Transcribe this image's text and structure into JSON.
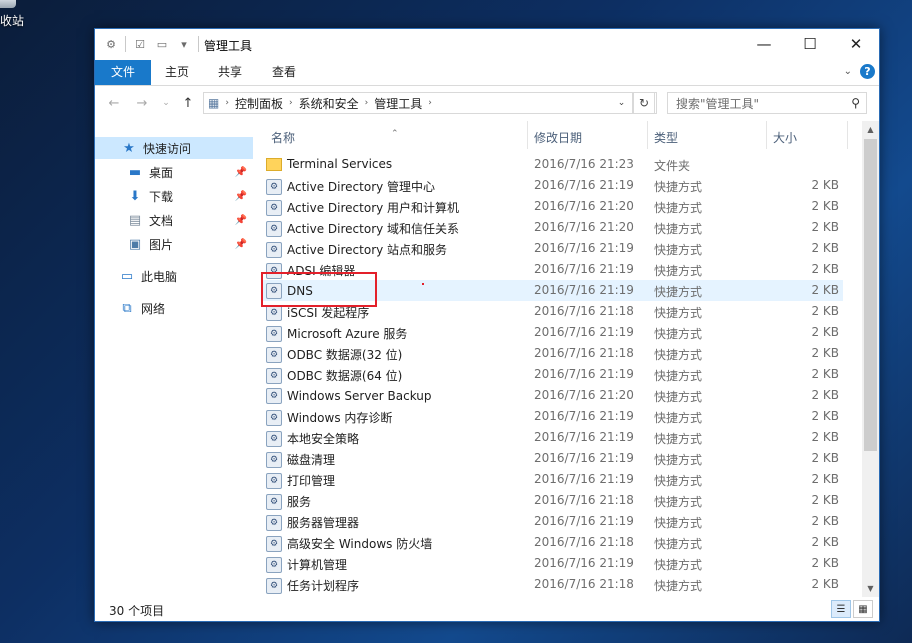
{
  "desktop": {
    "recycle_label": "收站"
  },
  "window": {
    "title": "管理工具",
    "controls": {
      "minimize": "—",
      "maximize": "☐",
      "close": "✕"
    }
  },
  "ribbon": {
    "tabs": {
      "file": "文件",
      "home": "主页",
      "share": "共享",
      "view": "查看"
    },
    "help": "?"
  },
  "address": {
    "crumbs": [
      "控制面板",
      "系统和安全",
      "管理工具"
    ],
    "search_placeholder": "搜索\"管理工具\""
  },
  "navpane": {
    "quick_access": "快速访问",
    "desktop": "桌面",
    "downloads": "下载",
    "documents": "文档",
    "pictures": "图片",
    "this_pc": "此电脑",
    "network": "网络"
  },
  "columns": {
    "name": "名称",
    "date": "修改日期",
    "type": "类型",
    "size": "大小"
  },
  "files": [
    {
      "name": "Terminal Services",
      "date": "2016/7/16 21:23",
      "type": "文件夹",
      "size": ""
    },
    {
      "name": "Active Directory 管理中心",
      "date": "2016/7/16 21:19",
      "type": "快捷方式",
      "size": "2 KB"
    },
    {
      "name": "Active Directory 用户和计算机",
      "date": "2016/7/16 21:20",
      "type": "快捷方式",
      "size": "2 KB"
    },
    {
      "name": "Active Directory 域和信任关系",
      "date": "2016/7/16 21:20",
      "type": "快捷方式",
      "size": "2 KB"
    },
    {
      "name": "Active Directory 站点和服务",
      "date": "2016/7/16 21:19",
      "type": "快捷方式",
      "size": "2 KB"
    },
    {
      "name": "ADSI 编辑器",
      "date": "2016/7/16 21:19",
      "type": "快捷方式",
      "size": "2 KB"
    },
    {
      "name": "DNS",
      "date": "2016/7/16 21:19",
      "type": "快捷方式",
      "size": "2 KB"
    },
    {
      "name": "iSCSI 发起程序",
      "date": "2016/7/16 21:18",
      "type": "快捷方式",
      "size": "2 KB"
    },
    {
      "name": "Microsoft Azure 服务",
      "date": "2016/7/16 21:19",
      "type": "快捷方式",
      "size": "2 KB"
    },
    {
      "name": "ODBC 数据源(32 位)",
      "date": "2016/7/16 21:18",
      "type": "快捷方式",
      "size": "2 KB"
    },
    {
      "name": "ODBC 数据源(64 位)",
      "date": "2016/7/16 21:19",
      "type": "快捷方式",
      "size": "2 KB"
    },
    {
      "name": "Windows Server Backup",
      "date": "2016/7/16 21:20",
      "type": "快捷方式",
      "size": "2 KB"
    },
    {
      "name": "Windows 内存诊断",
      "date": "2016/7/16 21:19",
      "type": "快捷方式",
      "size": "2 KB"
    },
    {
      "name": "本地安全策略",
      "date": "2016/7/16 21:19",
      "type": "快捷方式",
      "size": "2 KB"
    },
    {
      "name": "磁盘清理",
      "date": "2016/7/16 21:19",
      "type": "快捷方式",
      "size": "2 KB"
    },
    {
      "name": "打印管理",
      "date": "2016/7/16 21:19",
      "type": "快捷方式",
      "size": "2 KB"
    },
    {
      "name": "服务",
      "date": "2016/7/16 21:18",
      "type": "快捷方式",
      "size": "2 KB"
    },
    {
      "name": "服务器管理器",
      "date": "2016/7/16 21:19",
      "type": "快捷方式",
      "size": "2 KB"
    },
    {
      "name": "高级安全 Windows 防火墙",
      "date": "2016/7/16 21:18",
      "type": "快捷方式",
      "size": "2 KB"
    },
    {
      "name": "计算机管理",
      "date": "2016/7/16 21:19",
      "type": "快捷方式",
      "size": "2 KB"
    },
    {
      "name": "任务计划程序",
      "date": "2016/7/16 21:18",
      "type": "快捷方式",
      "size": "2 KB"
    }
  ],
  "status": {
    "count": "30 个项目"
  },
  "colors": {
    "accent": "#1979ca",
    "highlight_box": "#e3202a",
    "selected_row": "#e5f3ff"
  }
}
